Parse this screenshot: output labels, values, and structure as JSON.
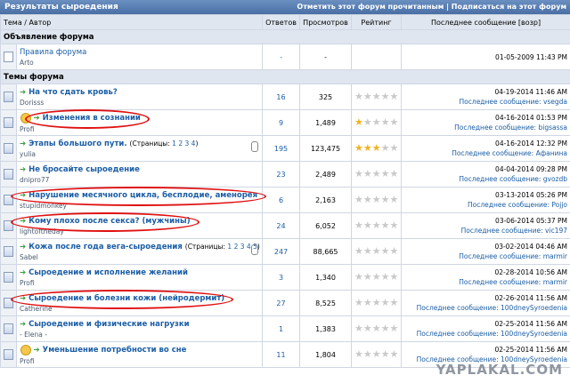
{
  "header": {
    "title": "Результаты сыроедения",
    "mark_read": "Отметить этот форум прочитанным",
    "subscribe": "Подписаться на этот форум",
    "sep": "|"
  },
  "columns": {
    "topic": "Тема / Автор",
    "replies": "Ответов",
    "views": "Просмотров",
    "rating": "Рейтинг",
    "last": "Последнее сообщение [возр]"
  },
  "sections": {
    "announce": "Объявление форума",
    "topics": "Темы форума"
  },
  "announcement": {
    "title": "Правила форума",
    "author": "Arto",
    "replies": "-",
    "views": "-",
    "date": "01-05-2009 11:43 PM"
  },
  "last_prefix": "Последнее сообщение:",
  "topics": [
    {
      "title": "На что сдать кровь?",
      "author": "Dorisss",
      "replies": "16",
      "views": "325",
      "rating": 0,
      "date": "04-19-2014 11:46 AM",
      "last_by": "vsegda",
      "smile": false
    },
    {
      "title": "Изменения в сознании",
      "author": "Profi",
      "replies": "9",
      "views": "1,489",
      "rating": 1,
      "date": "04-16-2014 01:53 PM",
      "last_by": "bigsassa",
      "smile": true
    },
    {
      "title": "Этапы большого пути.",
      "author": "yulia",
      "replies": "195",
      "views": "123,475",
      "rating": 3,
      "date": "04-16-2014 12:32 PM",
      "last_by": "Афанина",
      "smile": false,
      "pages_label": "(Страницы:",
      "pages": [
        "1",
        "2",
        "3",
        "4"
      ],
      "pages_end": ")"
    },
    {
      "title": "Не бросайте сыроедение",
      "author": "dnipro77",
      "replies": "23",
      "views": "2,489",
      "rating": 0,
      "date": "04-04-2014 09:28 PM",
      "last_by": "gvozdb",
      "smile": false
    },
    {
      "title": "Нарушение месячного цикла, бесплодие, аменорея",
      "author": "stupidmonkey",
      "replies": "6",
      "views": "2,163",
      "rating": 0,
      "date": "03-13-2014 05:26 PM",
      "last_by": "Pojjo",
      "smile": false
    },
    {
      "title": "Кому плохо после секса? (мужчины)",
      "author": "lightoftheday",
      "replies": "24",
      "views": "6,052",
      "rating": 0,
      "date": "03-06-2014 05:37 PM",
      "last_by": "vic197",
      "smile": false
    },
    {
      "title": "Кожа после года вега-сыроедения",
      "author": "Sabel",
      "replies": "247",
      "views": "88,665",
      "rating": 0,
      "date": "03-02-2014 04:46 AM",
      "last_by": "marmir",
      "smile": false,
      "pages_label": "(Страницы:",
      "pages": [
        "1",
        "2",
        "3",
        "4",
        "5"
      ],
      "pages_end": ")"
    },
    {
      "title": "Сыроедение и исполнение желаний",
      "author": "Profi",
      "replies": "3",
      "views": "1,340",
      "rating": 0,
      "date": "02-28-2014 10:56 AM",
      "last_by": "marmir",
      "smile": false
    },
    {
      "title": "Сыроедение и болезни кожи (нейродермит)",
      "author": "Catherine",
      "replies": "27",
      "views": "8,525",
      "rating": 0,
      "date": "02-26-2014 11:56 AM",
      "last_by": "100dneySyroedenia",
      "smile": false
    },
    {
      "title": "Сыроедение и физические нагрузки",
      "author": "- Elena -",
      "replies": "1",
      "views": "1,383",
      "rating": 0,
      "date": "02-25-2014 11:56 AM",
      "last_by": "100dneySyroedenia",
      "smile": false
    },
    {
      "title": "Уменьшение потребности во сне",
      "author": "Profi",
      "replies": "11",
      "views": "1,804",
      "rating": 0,
      "date": "02-25-2014 11:56 AM",
      "last_by": "100dneySyroedenia",
      "smile": true
    }
  ],
  "watermark": "YAPLAKAL.COM",
  "colors": {
    "header": "#4a6fa5",
    "link": "#1b5ea6",
    "highlight": "#e01010",
    "star": "#f0b21e"
  }
}
